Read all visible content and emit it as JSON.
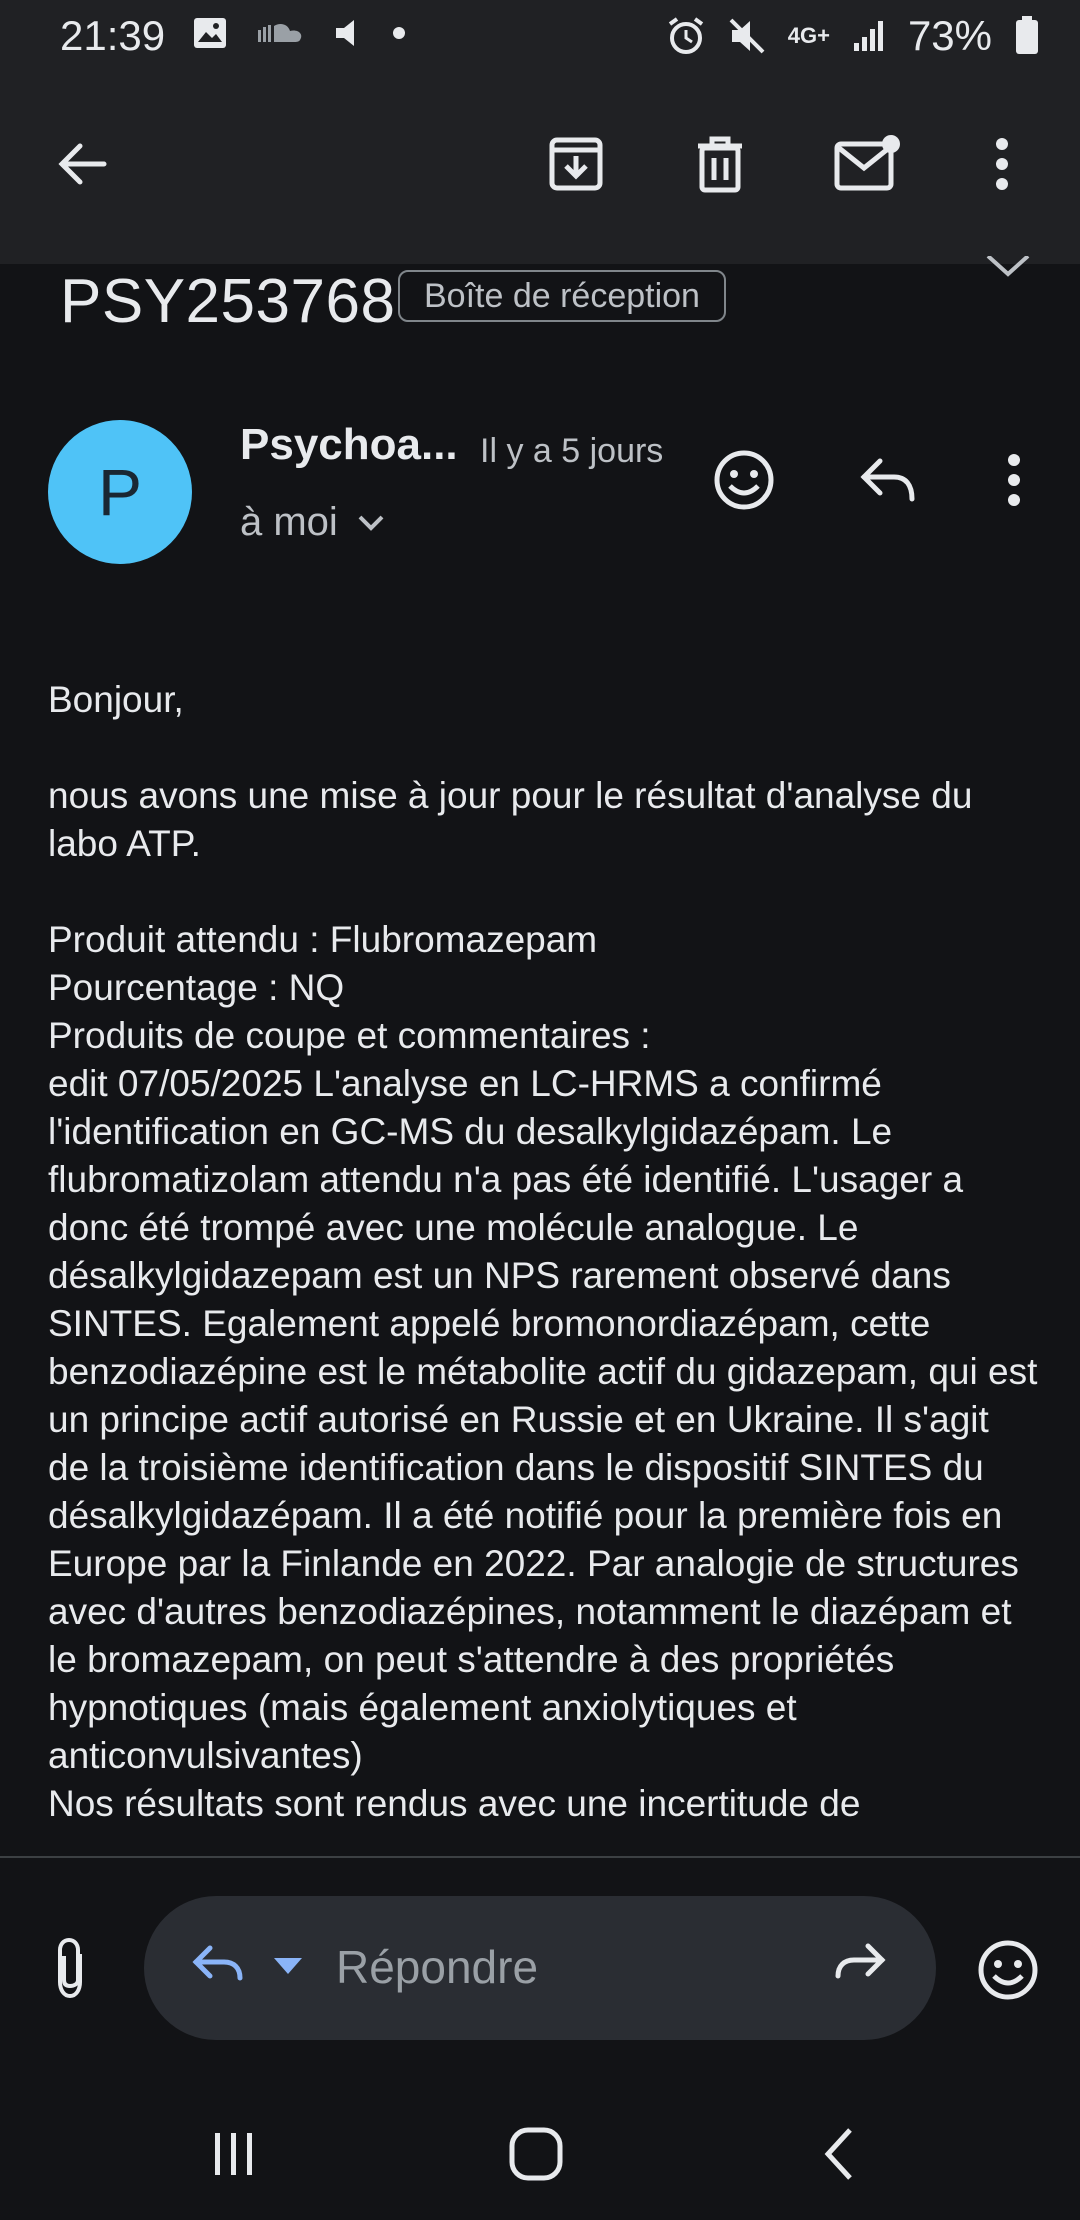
{
  "status_bar": {
    "time": "21:39",
    "battery": "73%",
    "network": "4G+"
  },
  "toolbar": {
    "back_icon": "arrow-back-icon",
    "archive_icon": "archive-icon",
    "delete_icon": "trash-icon",
    "mark_unread_icon": "mail-unread-icon",
    "more_icon": "more-vert-icon"
  },
  "email": {
    "subject": "PSY253768",
    "label": "Boîte de réception",
    "sender_initial": "P",
    "sender_name": "Psychoa...",
    "time_ago": "Il y a 5 jours",
    "recipient": "à moi",
    "body": {
      "greeting": "Bonjour,",
      "intro": "nous avons une mise à jour pour le résultat d'analyse du labo ATP.",
      "line_product": "Produit attendu : Flubromazepam",
      "line_percent": "Pourcentage : NQ",
      "line_comments_label": "Produits de coupe et commentaires :",
      "comment": "edit 07/05/2025 L'analyse en LC-HRMS a confirmé l'identification en GC-MS du desalkylgidazépam. Le flubromatizolam attendu n'a pas été identifié. L'usager a donc été trompé avec une molécule analogue. Le désalkylgidazepam est un NPS rarement observé dans SINTES. Egalement appelé bromonordiazépam, cette benzodiazépine est le métabolite actif du gidazepam, qui est un principe actif autorisé en Russie et en Ukraine. Il s'agit de la troisième identification dans le dispositif SINTES du désalkylgidazépam. Il a été notifié pour la première fois en Europe par la Finlande en 2022. Par analogie de structures avec d'autres benzodiazépines, notamment le diazépam et le bromazepam, on peut s'attendre à des propriétés hypnotiques (mais également anxiolytiques et anticonvulsivantes)",
      "trailing": "Nos résultats sont rendus avec une incertitude de"
    }
  },
  "reply_bar": {
    "placeholder": "Répondre"
  },
  "colors": {
    "background": "#121316",
    "toolbar": "#202124",
    "avatar": "#4fc3f7",
    "reply_accent": "#8ab4f8"
  }
}
